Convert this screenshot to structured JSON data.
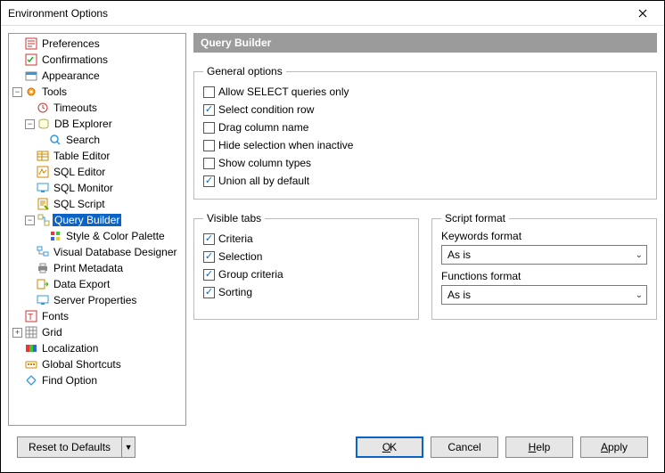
{
  "title": "Environment Options",
  "tree": {
    "preferences": "Preferences",
    "confirmations": "Confirmations",
    "appearance": "Appearance",
    "tools": "Tools",
    "timeouts": "Timeouts",
    "db_explorer": "DB Explorer",
    "search": "Search",
    "table_editor": "Table Editor",
    "sql_editor": "SQL Editor",
    "sql_monitor": "SQL Monitor",
    "sql_script": "SQL Script",
    "query_builder": "Query Builder",
    "style_palette": "Style & Color Palette",
    "vdd": "Visual Database Designer",
    "print_metadata": "Print Metadata",
    "data_export": "Data Export",
    "server_properties": "Server Properties",
    "fonts": "Fonts",
    "grid": "Grid",
    "localization": "Localization",
    "global_shortcuts": "Global Shortcuts",
    "find_option": "Find Option"
  },
  "header": "Query Builder",
  "groups": {
    "general": "General options",
    "visible_tabs": "Visible tabs",
    "script_format": "Script format"
  },
  "general_options": {
    "allow_select_only": {
      "label": "Allow SELECT queries only",
      "checked": false
    },
    "select_condition_row": {
      "label": "Select condition row",
      "checked": true
    },
    "drag_column_name": {
      "label": "Drag column name",
      "checked": false
    },
    "hide_selection_inactive": {
      "label": "Hide selection when inactive",
      "checked": false
    },
    "show_column_types": {
      "label": "Show column types",
      "checked": false
    },
    "union_all_default": {
      "label": "Union all by default",
      "checked": true
    }
  },
  "visible_tabs": {
    "criteria": {
      "label": "Criteria",
      "checked": true
    },
    "selection": {
      "label": "Selection",
      "checked": true
    },
    "group_criteria": {
      "label": "Group criteria",
      "checked": true
    },
    "sorting": {
      "label": "Sorting",
      "checked": true
    }
  },
  "script_format": {
    "keywords_label": "Keywords format",
    "keywords_value": "As is",
    "functions_label": "Functions format",
    "functions_value": "As is"
  },
  "buttons": {
    "reset": "Reset to Defaults",
    "ok": "OK",
    "cancel": "Cancel",
    "help": "Help",
    "apply": "Apply"
  }
}
